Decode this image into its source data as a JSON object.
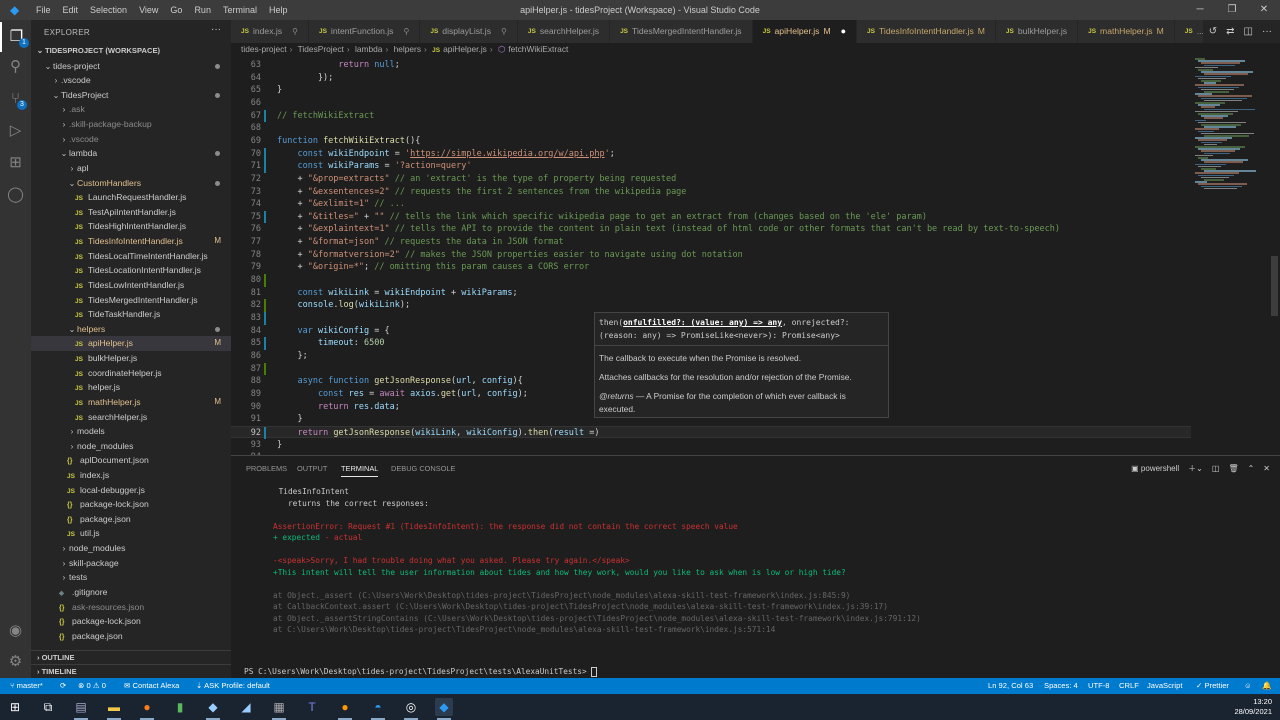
{
  "window": {
    "title": "apiHelper.js - tidesProject (Workspace) - Visual Studio Code",
    "menu": [
      "File",
      "Edit",
      "Selection",
      "View",
      "Go",
      "Run",
      "Terminal",
      "Help"
    ]
  },
  "icons": {
    "js": "JS",
    "json": "{}"
  },
  "activity_bar": {
    "explorer_badge": "1",
    "scm_badge": "3"
  },
  "sidebar": {
    "title": "EXPLORER",
    "tree": [
      {
        "label": "TIDESPROJECT (WORKSPACE)",
        "depth": 0,
        "kind": "root"
      },
      {
        "label": "tides-project",
        "depth": 1,
        "kind": "open",
        "status": "dot"
      },
      {
        "label": ".vscode",
        "depth": 2,
        "kind": "closed"
      },
      {
        "label": "TidesProject",
        "depth": 2,
        "kind": "open",
        "status": "dot"
      },
      {
        "label": ".ask",
        "depth": 3,
        "kind": "closed",
        "status": "ignored"
      },
      {
        "label": ".skill-package-backup",
        "depth": 3,
        "kind": "closed",
        "status": "ignored"
      },
      {
        "label": ".vscode",
        "depth": 3,
        "kind": "closed",
        "status": "ignored"
      },
      {
        "label": "lambda",
        "depth": 3,
        "kind": "open",
        "status": "dot"
      },
      {
        "label": "apl",
        "depth": 4,
        "kind": "closed"
      },
      {
        "label": "CustomHandlers",
        "depth": 4,
        "kind": "open",
        "status": "dot",
        "modified": true
      },
      {
        "label": "LaunchRequestHandler.js",
        "depth": 5,
        "kind": "js"
      },
      {
        "label": "TestApiIntentHandler.js",
        "depth": 5,
        "kind": "js"
      },
      {
        "label": "TidesHighIntentHandler.js",
        "depth": 5,
        "kind": "js"
      },
      {
        "label": "TidesInfoIntentHandler.js",
        "depth": 5,
        "kind": "js",
        "status": "M"
      },
      {
        "label": "TidesLocalTimeIntentHandler.js",
        "depth": 5,
        "kind": "js"
      },
      {
        "label": "TidesLocationIntentHandler.js",
        "depth": 5,
        "kind": "js"
      },
      {
        "label": "TidesLowIntentHandler.js",
        "depth": 5,
        "kind": "js"
      },
      {
        "label": "TidesMergedIntentHandler.js",
        "depth": 5,
        "kind": "js"
      },
      {
        "label": "TideTaskHandler.js",
        "depth": 5,
        "kind": "js"
      },
      {
        "label": "helpers",
        "depth": 4,
        "kind": "open",
        "status": "dot",
        "modified": true
      },
      {
        "label": "apiHelper.js",
        "depth": 5,
        "kind": "js",
        "status": "M",
        "selected": true
      },
      {
        "label": "bulkHelper.js",
        "depth": 5,
        "kind": "js"
      },
      {
        "label": "coordinateHelper.js",
        "depth": 5,
        "kind": "js"
      },
      {
        "label": "helper.js",
        "depth": 5,
        "kind": "js"
      },
      {
        "label": "mathHelper.js",
        "depth": 5,
        "kind": "js",
        "status": "M"
      },
      {
        "label": "searchHelper.js",
        "depth": 5,
        "kind": "js"
      },
      {
        "label": "models",
        "depth": 4,
        "kind": "closed"
      },
      {
        "label": "node_modules",
        "depth": 4,
        "kind": "closed"
      },
      {
        "label": "aplDocument.json",
        "depth": 4,
        "kind": "json"
      },
      {
        "label": "index.js",
        "depth": 4,
        "kind": "js"
      },
      {
        "label": "local-debugger.js",
        "depth": 4,
        "kind": "js"
      },
      {
        "label": "package-lock.json",
        "depth": 4,
        "kind": "json"
      },
      {
        "label": "package.json",
        "depth": 4,
        "kind": "json"
      },
      {
        "label": "util.js",
        "depth": 4,
        "kind": "js"
      },
      {
        "label": "node_modules",
        "depth": 3,
        "kind": "closed"
      },
      {
        "label": "skill-package",
        "depth": 3,
        "kind": "closed"
      },
      {
        "label": "tests",
        "depth": 3,
        "kind": "closed"
      },
      {
        "label": ".gitignore",
        "depth": 3,
        "kind": "git"
      },
      {
        "label": "ask-resources.json",
        "depth": 3,
        "kind": "json",
        "status": "ignored"
      },
      {
        "label": "package-lock.json",
        "depth": 3,
        "kind": "json"
      },
      {
        "label": "package.json",
        "depth": 3,
        "kind": "json"
      }
    ],
    "sections": [
      "OUTLINE",
      "TIMELINE"
    ]
  },
  "tabs": [
    {
      "label": "index.js",
      "pinned": true
    },
    {
      "label": "intentFunction.js",
      "pinned": true
    },
    {
      "label": "displayList.js",
      "pinned": true
    },
    {
      "label": "searchHelper.js"
    },
    {
      "label": "TidesMergedIntentHandler.js"
    },
    {
      "label": "apiHelper.js",
      "badge": "M",
      "active": true,
      "dirty": true
    },
    {
      "label": "TidesInfoIntentHandler.js",
      "badge": "M"
    },
    {
      "label": "bulkHelper.js"
    },
    {
      "label": "mathHelper.js",
      "badge": "M"
    },
    {
      "label": "..."
    }
  ],
  "breadcrumb": [
    "tides-project",
    "TidesProject",
    "lambda",
    "helpers",
    "apiHelper.js",
    "fetchWikiExtract"
  ],
  "editor": {
    "current_line": 92,
    "lines": [
      {
        "n": 63,
        "tokens": [
          [
            "            ",
            "p"
          ],
          [
            "return ",
            "ctl"
          ],
          [
            "null",
            "kw"
          ],
          [
            ";",
            "p"
          ]
        ]
      },
      {
        "n": 64,
        "tokens": [
          [
            "        });",
            "p"
          ]
        ]
      },
      {
        "n": 65,
        "tokens": [
          [
            "}",
            "p"
          ]
        ]
      },
      {
        "n": 66,
        "tokens": []
      },
      {
        "n": 67,
        "git": "m",
        "tokens": [
          [
            "// fetchWikiExtract",
            "cm"
          ]
        ]
      },
      {
        "n": 68,
        "tokens": []
      },
      {
        "n": 69,
        "tokens": [
          [
            "function ",
            "kw"
          ],
          [
            "fetchWikiExtract",
            "fn"
          ],
          [
            "(){",
            "p"
          ]
        ]
      },
      {
        "n": 70,
        "git": "m",
        "tokens": [
          [
            "    const ",
            "kw"
          ],
          [
            "wikiEndpoint",
            "var"
          ],
          [
            " = ",
            "p"
          ],
          [
            "'",
            "str"
          ],
          [
            "https://simple.wikipedia.org/w/api.php",
            "url"
          ],
          [
            "'",
            "str"
          ],
          [
            ";",
            "p"
          ]
        ]
      },
      {
        "n": 71,
        "git": "m",
        "tokens": [
          [
            "    const ",
            "kw"
          ],
          [
            "wikiParams",
            "var"
          ],
          [
            " = ",
            "p"
          ],
          [
            "'?action=query'",
            "str"
          ]
        ]
      },
      {
        "n": 72,
        "tokens": [
          [
            "    + ",
            "p"
          ],
          [
            "\"&prop=extracts\"",
            "str"
          ],
          [
            " // an 'extract' is the type of property being requested",
            "cm"
          ]
        ]
      },
      {
        "n": 73,
        "tokens": [
          [
            "    + ",
            "p"
          ],
          [
            "\"&exsentences=2\"",
            "str"
          ],
          [
            " // requests the first 2 sentences from the wikipedia page",
            "cm"
          ]
        ]
      },
      {
        "n": 74,
        "tokens": [
          [
            "    + ",
            "p"
          ],
          [
            "\"&exlimit=1\"",
            "str"
          ],
          [
            " // ...",
            "cm"
          ]
        ]
      },
      {
        "n": 75,
        "git": "m",
        "tokens": [
          [
            "    + ",
            "p"
          ],
          [
            "\"&titles=\"",
            "str"
          ],
          [
            " + ",
            "p"
          ],
          [
            "\"\"",
            "str"
          ],
          [
            " // tells the link which specific wikipedia page to get an extract from (changes based on the 'ele' param)",
            "cm"
          ]
        ]
      },
      {
        "n": 76,
        "tokens": [
          [
            "    + ",
            "p"
          ],
          [
            "\"&explaintext=1\"",
            "str"
          ],
          [
            " // tells the API to provide the content in plain text (instead of html code or other formats that can't be read by text-to-speech)",
            "cm"
          ]
        ]
      },
      {
        "n": 77,
        "tokens": [
          [
            "    + ",
            "p"
          ],
          [
            "\"&format=json\"",
            "str"
          ],
          [
            " // requests the data in JSON format",
            "cm"
          ]
        ]
      },
      {
        "n": 78,
        "tokens": [
          [
            "    + ",
            "p"
          ],
          [
            "\"&formatversion=2\"",
            "str"
          ],
          [
            " // makes the JSON properties easier to navigate using dot notation",
            "cm"
          ]
        ]
      },
      {
        "n": 79,
        "tokens": [
          [
            "    + ",
            "p"
          ],
          [
            "\"&origin=*\"",
            "str"
          ],
          [
            "; ",
            "p"
          ],
          [
            "// omitting this param causes a CORS error",
            "cm"
          ]
        ]
      },
      {
        "n": 80,
        "git": "a",
        "tokens": []
      },
      {
        "n": 81,
        "tokens": [
          [
            "    const ",
            "kw"
          ],
          [
            "wikiLink",
            "var"
          ],
          [
            " = ",
            "p"
          ],
          [
            "wikiEndpoint",
            "var"
          ],
          [
            " + ",
            "p"
          ],
          [
            "wikiParams",
            "var"
          ],
          [
            ";",
            "p"
          ]
        ]
      },
      {
        "n": 82,
        "git": "a",
        "tokens": [
          [
            "    ",
            "p"
          ],
          [
            "console",
            "var"
          ],
          [
            ".",
            "p"
          ],
          [
            "log",
            "fn"
          ],
          [
            "(",
            "p"
          ],
          [
            "wikiLink",
            "var"
          ],
          [
            ");",
            "p"
          ]
        ]
      },
      {
        "n": 83,
        "git": "m",
        "tokens": []
      },
      {
        "n": 84,
        "tokens": [
          [
            "    var ",
            "kw"
          ],
          [
            "wikiConfig",
            "var"
          ],
          [
            " = {",
            "p"
          ]
        ]
      },
      {
        "n": 85,
        "git": "m",
        "tokens": [
          [
            "        ",
            "p"
          ],
          [
            "timeout",
            "prop"
          ],
          [
            ": ",
            "p"
          ],
          [
            "6500",
            "num"
          ]
        ]
      },
      {
        "n": 86,
        "tokens": [
          [
            "    };",
            "p"
          ]
        ]
      },
      {
        "n": 87,
        "git": "a",
        "tokens": []
      },
      {
        "n": 88,
        "tokens": [
          [
            "    async function ",
            "kw"
          ],
          [
            "getJsonResponse",
            "fn"
          ],
          [
            "(",
            "p"
          ],
          [
            "url",
            "var"
          ],
          [
            ", ",
            "p"
          ],
          [
            "config",
            "var"
          ],
          [
            "){",
            "p"
          ]
        ]
      },
      {
        "n": 89,
        "tokens": [
          [
            "        const ",
            "kw"
          ],
          [
            "res",
            "var"
          ],
          [
            " = ",
            "p"
          ],
          [
            "await ",
            "ctl"
          ],
          [
            "axios",
            "var"
          ],
          [
            ".",
            "p"
          ],
          [
            "get",
            "fn"
          ],
          [
            "(",
            "p"
          ],
          [
            "url",
            "var"
          ],
          [
            ", ",
            "p"
          ],
          [
            "config",
            "var"
          ],
          [
            ");",
            "p"
          ]
        ]
      },
      {
        "n": 90,
        "tokens": [
          [
            "        ",
            "p"
          ],
          [
            "return ",
            "ctl"
          ],
          [
            "res",
            "var"
          ],
          [
            ".",
            "p"
          ],
          [
            "data",
            "var"
          ],
          [
            ";",
            "p"
          ]
        ]
      },
      {
        "n": 91,
        "tokens": [
          [
            "    }",
            "p"
          ]
        ]
      },
      {
        "n": 92,
        "git": "m",
        "tokens": [
          [
            "    ",
            "p"
          ],
          [
            "return ",
            "ctl"
          ],
          [
            "getJsonResponse",
            "fn"
          ],
          [
            "(",
            "p"
          ],
          [
            "wikiLink",
            "var"
          ],
          [
            ", ",
            "p"
          ],
          [
            "wikiConfig",
            "var"
          ],
          [
            ").",
            "p"
          ],
          [
            "then",
            "fn"
          ],
          [
            "(",
            "p"
          ],
          [
            "result",
            "var"
          ],
          [
            " =)",
            "p"
          ]
        ]
      },
      {
        "n": 93,
        "tokens": [
          [
            "}",
            "p"
          ]
        ]
      },
      {
        "n": 94,
        "tokens": []
      }
    ],
    "hover": {
      "sig_pre": "then(",
      "sig_param": "onfulfilled?: (value: any) => any",
      "sig_post": ", onrejected?: (reason: any) => PromiseLike<never>): Promise<any>",
      "param_doc": "The callback to execute when the Promise is resolved.",
      "description": "Attaches callbacks for the resolution and/or rejection of the Promise.",
      "returns_tag": "@returns",
      "returns_text": " — A Promise for the completion of which ever callback is executed."
    }
  },
  "panel": {
    "tabs": [
      "PROBLEMS",
      "OUTPUT",
      "TERMINAL",
      "DEBUG CONSOLE"
    ],
    "active_tab": "TERMINAL",
    "shell": "powershell",
    "terminal": [
      {
        "text": "TidesInfoIntent",
        "style": "w",
        "indent": 6,
        "row": 0
      },
      {
        "text": "  returns the correct responses:",
        "style": "w",
        "indent": 6,
        "row": 1
      },
      {
        "text": "AssertionError: Request #1 (TidesInfoIntent): the response did not contain the correct speech value",
        "style": "r",
        "indent": 5,
        "row": 3
      },
      {
        "text": "+ expected",
        "style": "g",
        "indent": 5,
        "row": 4,
        "tail": " - actual"
      },
      {
        "text": "-<speak>Sorry, I had trouble doing what you asked. Please try again.</speak>",
        "style": "r",
        "indent": 5,
        "row": 6
      },
      {
        "text": "+This intent will tell the user information about tides and how they work, would you like to ask when is low or high tide?",
        "style": "g",
        "indent": 5,
        "row": 7
      },
      {
        "text": "at Object._assert (C:\\Users\\Work\\Desktop\\tides-project\\TidesProject\\node_modules\\alexa-skill-test-framework\\index.js:845:9)",
        "style": "d",
        "indent": 5,
        "row": 9
      },
      {
        "text": "at CallbackContext.assert (C:\\Users\\Work\\Desktop\\tides-project\\TidesProject\\node_modules\\alexa-skill-test-framework\\index.js:39:17)",
        "style": "d",
        "indent": 5,
        "row": 10
      },
      {
        "text": "at Object._assertStringContains (C:\\Users\\Work\\Desktop\\tides-project\\TidesProject\\node_modules\\alexa-skill-test-framework\\index.js:791:12)",
        "style": "d",
        "indent": 5,
        "row": 11
      },
      {
        "text": "at C:\\Users\\Work\\Desktop\\tides-project\\TidesProject\\node_modules\\alexa-skill-test-framework\\index.js:571:14",
        "style": "d",
        "indent": 5,
        "row": 12
      }
    ],
    "prompt": "PS C:\\Users\\Work\\Desktop\\tides-project\\TidesProject\\tests\\AlexaUnitTests> "
  },
  "statusbar": {
    "branch": "master*",
    "errors": "0",
    "warnings": "0",
    "contact": "Contact Alexa",
    "ask_profile": "ASK Profile: default",
    "position": "Ln 92, Col 63",
    "spaces": "Spaces: 4",
    "encoding": "UTF-8",
    "eol": "CRLF",
    "language": "JavaScript",
    "formatter": "Prettier"
  },
  "taskbar": {
    "time": "13:20",
    "date": "28/09/2021"
  },
  "colors": {
    "accent": "#007acc",
    "modified": "#e2c08d",
    "error": "#cd3131",
    "success": "#0dbc79"
  }
}
